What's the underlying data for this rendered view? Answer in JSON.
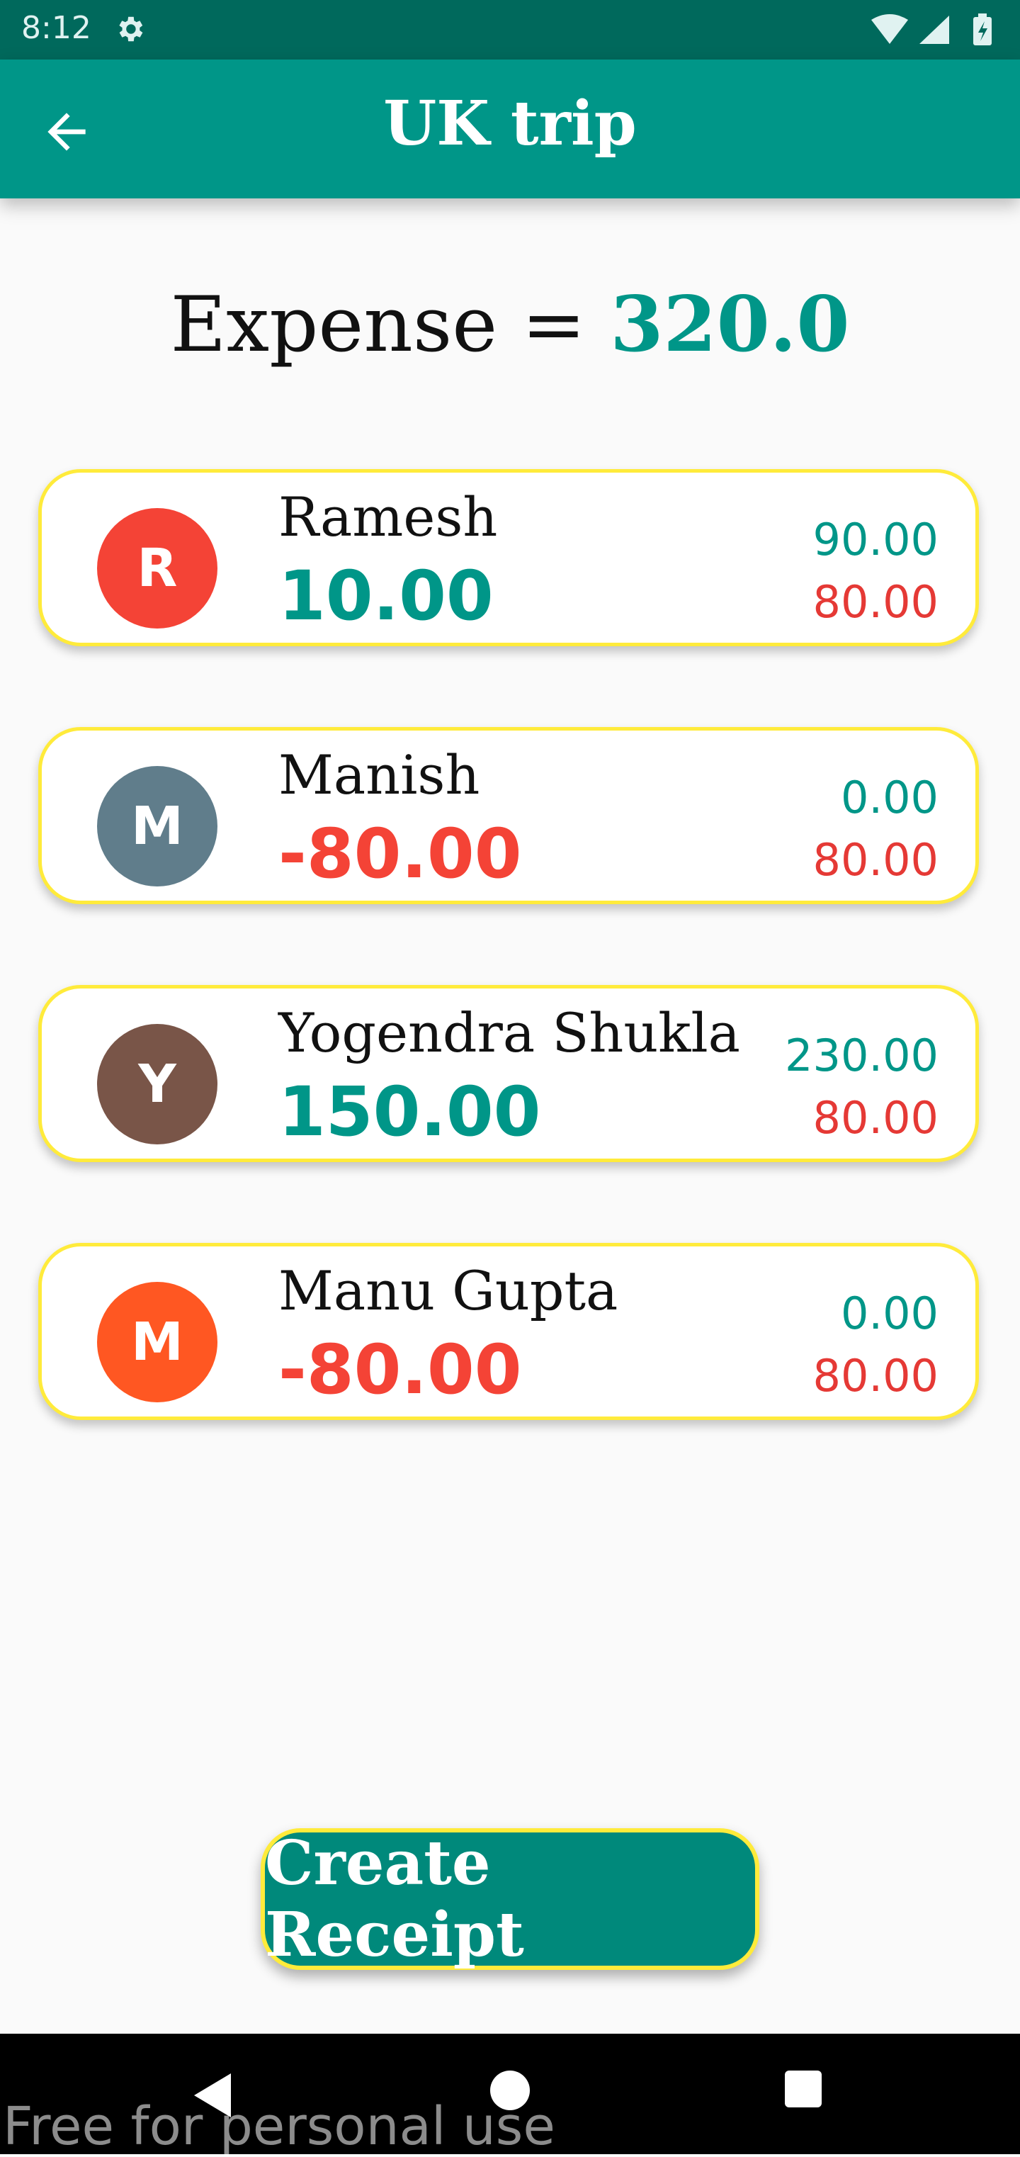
{
  "status_bar": {
    "time": "8:12",
    "icons": [
      "settings-icon",
      "wifi-icon",
      "signal-icon",
      "battery-icon"
    ]
  },
  "app_bar": {
    "title": "UK trip",
    "back_icon": "arrow-left-icon",
    "color": "#009688"
  },
  "expense": {
    "label": "Expense =",
    "total": "320.0"
  },
  "members": [
    {
      "initial": "R",
      "name": "Ramesh",
      "balance": "10.00",
      "paid": "90.00",
      "share": "80.00",
      "avatar_color": "#f44336",
      "balance_color": "#009688"
    },
    {
      "initial": "M",
      "name": "Manish",
      "balance": "-80.00",
      "paid": "0.00",
      "share": "80.00",
      "avatar_color": "#607d8b",
      "balance_color": "#f44336"
    },
    {
      "initial": "Y",
      "name": "Yogendra Shukla",
      "balance": "150.00",
      "paid": "230.00",
      "share": "80.00",
      "avatar_color": "#795548",
      "balance_color": "#009688"
    },
    {
      "initial": "M",
      "name": "Manu Gupta",
      "balance": "-80.00",
      "paid": "0.00",
      "share": "80.00",
      "avatar_color": "#ff5722",
      "balance_color": "#f44336"
    }
  ],
  "colors": {
    "paid": "#009688",
    "share": "#e53935",
    "card_border": "#ffeb3b"
  },
  "create_receipt": {
    "label": "Create Receipt"
  },
  "nav_bar": {
    "icons": [
      "back-triangle-icon",
      "home-circle-icon",
      "recents-square-icon"
    ]
  },
  "watermark": "Free for personal use"
}
